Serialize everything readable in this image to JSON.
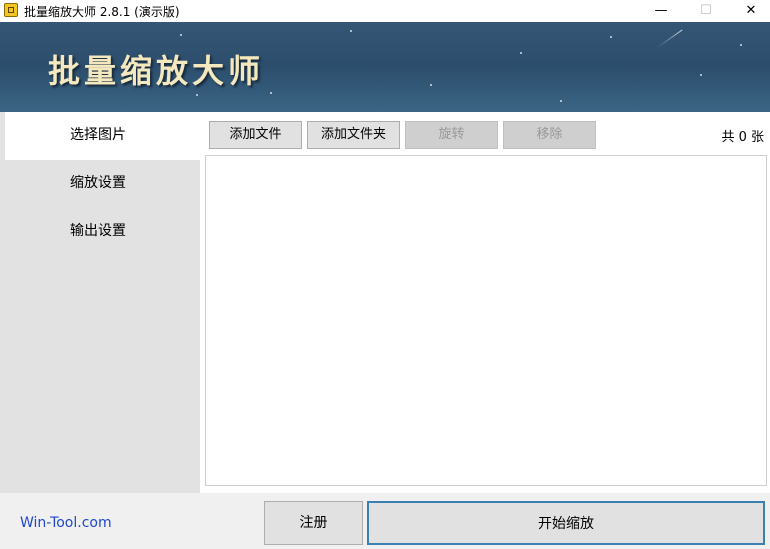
{
  "window": {
    "title": "批量缩放大师 2.8.1 (演示版)",
    "minimize_glyph": "—",
    "maximize_glyph": "☐",
    "close_glyph": "✕"
  },
  "banner": {
    "title": "批量缩放大师"
  },
  "sidebar": {
    "items": [
      {
        "label": "选择图片",
        "active": true
      },
      {
        "label": "缩放设置",
        "active": false
      },
      {
        "label": "输出设置",
        "active": false
      }
    ]
  },
  "toolbar": {
    "add_file": "添加文件",
    "add_folder": "添加文件夹",
    "rotate": "旋转",
    "remove": "移除",
    "count": "共 0 张"
  },
  "footer": {
    "site": "Win-Tool.com",
    "register": "注册",
    "start": "开始缩放"
  },
  "colors": {
    "banner": "#2c4e6c",
    "banner_title": "#f4e8bf",
    "link": "#1f48c9",
    "primary_border": "#3c7fb1"
  }
}
